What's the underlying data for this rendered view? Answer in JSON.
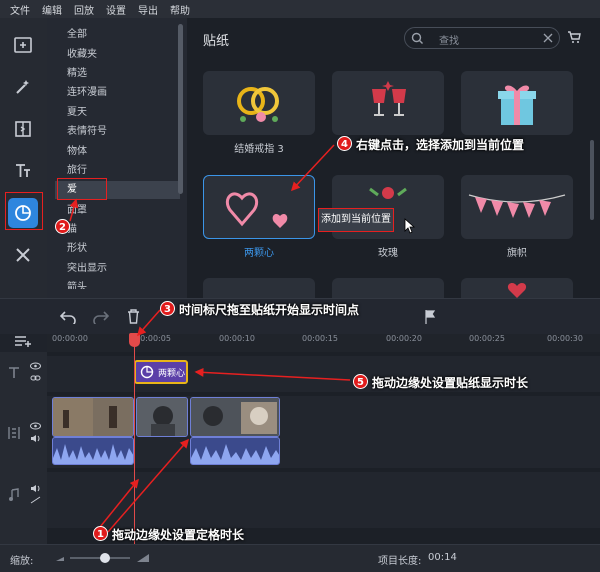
{
  "menu": [
    "文件",
    "编辑",
    "回放",
    "设置",
    "导出",
    "帮助"
  ],
  "categories": [
    {
      "label": "全部",
      "selected": false
    },
    {
      "label": "收藏夹",
      "selected": false
    },
    {
      "label": "精选",
      "selected": false
    },
    {
      "label": "连环漫画",
      "selected": false
    },
    {
      "label": "夏天",
      "selected": false
    },
    {
      "label": "表情符号",
      "selected": false
    },
    {
      "label": "物体",
      "selected": false
    },
    {
      "label": "旅行",
      "selected": false
    },
    {
      "label": "爱",
      "selected": true
    },
    {
      "label": "面罩",
      "selected": false
    },
    {
      "label": "猫",
      "selected": false
    },
    {
      "label": "形状",
      "selected": false
    },
    {
      "label": "突出显示",
      "selected": false
    },
    {
      "label": "箭头",
      "selected": false
    }
  ],
  "panel": {
    "title": "贴纸",
    "search_placeholder": "查找"
  },
  "stickers": [
    {
      "label": "结婚戒指 3"
    },
    {
      "label": ""
    },
    {
      "label": ""
    },
    {
      "label": "两颗心",
      "selected": true
    },
    {
      "label": "玫瑰"
    },
    {
      "label": "旗帜"
    }
  ],
  "context_menu": {
    "item": "添加到当前位置"
  },
  "timeline": {
    "ticks": [
      "00:00:00",
      "00:00:05",
      "00:00:10",
      "00:00:15",
      "00:00:20",
      "00:00:25",
      "00:00:30"
    ],
    "sticker_clip": "两颗心"
  },
  "bottom": {
    "zoom_label": "缩放:",
    "project_length_label": "项目长度:",
    "project_length": "00:14"
  },
  "annotations": [
    {
      "num": "1",
      "text": "拖动边缘处设置定格时长"
    },
    {
      "num": "2",
      "text": ""
    },
    {
      "num": "3",
      "text": "时间标尺拖至贴纸开始显示时间点"
    },
    {
      "num": "4",
      "text": "右键点击，选择添加到当前位置"
    },
    {
      "num": "5",
      "text": "拖动边缘处设置贴纸显示时长"
    }
  ],
  "colors": {
    "accent": "#3b95e8",
    "annotation": "#e62020",
    "playhead": "#e24a4a"
  }
}
